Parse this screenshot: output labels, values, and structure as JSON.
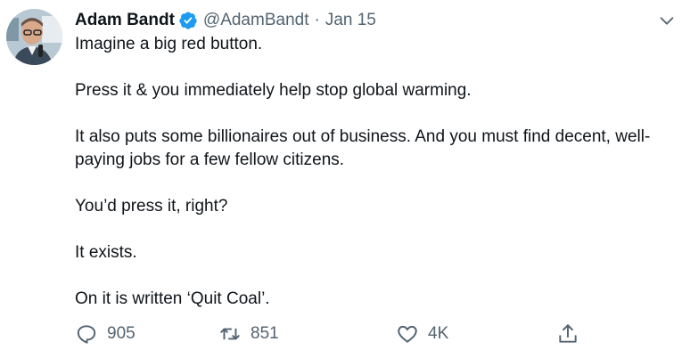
{
  "user": {
    "name": "Adam Bandt",
    "handle": "@AdamBandt",
    "separator": "·",
    "date": "Jan 15",
    "verified_color": "#1d9bf0"
  },
  "tweet": {
    "paragraphs": [
      "Imagine a big red button.",
      "Press it & you immediately help stop global warming.",
      "It also puts some billionaires out of business. And you must find decent, well-paying jobs for a few fellow citizens.",
      "You’d press it, right?",
      "It exists.",
      "On it is written ‘Quit Coal’."
    ]
  },
  "actions": {
    "reply_count": "905",
    "retweet_count": "851",
    "like_count": "4K"
  },
  "icons": {
    "reply": "reply-icon",
    "retweet": "retweet-icon",
    "like": "heart-icon",
    "share": "share-icon",
    "more": "chevron-down-icon"
  },
  "colors": {
    "text": "#0f1419",
    "secondary": "#536471",
    "accent": "#1d9bf0"
  }
}
